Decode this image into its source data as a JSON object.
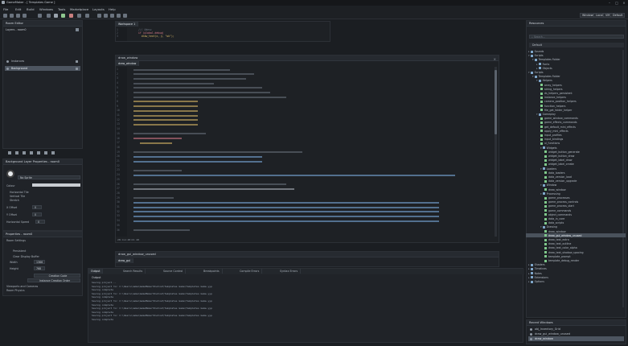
{
  "app": {
    "title": "GameMaker - [ Templates Game ]"
  },
  "menu": [
    "File",
    "Edit",
    "Build",
    "Windows",
    "Tools",
    "Marketplace",
    "Layouts",
    "Help"
  ],
  "layout_buttons": [
    "Windows",
    "Local",
    "VM",
    "Default",
    "Initial"
  ],
  "room_editor": {
    "title": "Room Editor",
    "room_name": "Layers - room0",
    "layers": [
      {
        "name": "Instances",
        "selected": false
      },
      {
        "name": "Background",
        "selected": true
      }
    ],
    "layer_props_title": "Background Layer Properties - room0",
    "colour_label": "Colour",
    "no_sprite": "No Sprite",
    "checks": [
      "Horizontal Tile",
      "Vertical Tile",
      "Stretch"
    ],
    "fields": [
      {
        "label": "X Offset",
        "value": "0"
      },
      {
        "label": "Y Offset",
        "value": "0"
      },
      {
        "label": "Horizontal Speed",
        "value": "0"
      }
    ],
    "room_props_title": "Properties - room0",
    "room_settings": "Room Settings",
    "persistent": "Persistent",
    "clear_display": "Clear Display Buffer",
    "width_label": "Width",
    "width_value": "1366",
    "height_label": "Height",
    "height_value": "768",
    "creation_code": "Creation Code",
    "instance_order": "Instance Creation Order",
    "viewports": "Viewports and Cameras",
    "physics": "Room Physics"
  },
  "script_small": {
    "tab": "Workspace 1",
    "lines": [
      "1",
      "2",
      "3"
    ],
    "code": [
      "/// @desc",
      "if (global.debug)",
      "  draw_text(x, y, \"ok\");"
    ]
  },
  "script_main": {
    "window_title": "draw_window",
    "tab": "draw_window",
    "lines": [
      "1",
      "2",
      "3",
      "4",
      "5",
      "6",
      "7",
      "8",
      "9",
      "10",
      "11",
      "12",
      "13",
      "14",
      "15",
      "16",
      "17",
      "18",
      "19",
      "20",
      "21",
      "22",
      "23",
      "24",
      "25",
      "26",
      "27",
      "28",
      "29",
      "30",
      "31",
      "32",
      "33",
      "34",
      "35",
      "36"
    ],
    "status": "28:  Col: 48  Ch: 48"
  },
  "script_footer": {
    "tab": "draw_gui",
    "title": "draw_gui_window_unused"
  },
  "output": {
    "tabs": [
      "Output",
      "Search Results",
      "Source Control",
      "Breakpoints",
      "Compile Errors",
      "Syntax Errors"
    ],
    "title": "Output",
    "lines": [
      "Saving project...",
      "Saving project to: C:\\Users\\name\\GameMakerStudio2\\Templates Game\\Templates Game.yyp",
      "Saving complete",
      "Saving project to: C:\\Users\\name\\GameMakerStudio2\\Templates Game\\Templates Game.yyp",
      "Saving complete",
      "Saving project to: C:\\Users\\name\\GameMakerStudio2\\Templates Game\\Templates Game.yyp",
      "Saving complete",
      "Saving project to: C:\\Users\\name\\GameMakerStudio2\\Templates Game\\Templates Game.yyp",
      "Saving complete",
      "Saving project to: C:\\Users\\name\\GameMakerStudio2\\Templates Game\\Templates Game.yyp",
      "Saving complete"
    ]
  },
  "resources": {
    "title": "Resources",
    "search_placeholder": "Search...",
    "filter": "Default",
    "tree": [
      {
        "d": 0,
        "t": "Sounds",
        "o": false
      },
      {
        "d": 0,
        "t": "Scripts",
        "o": true
      },
      {
        "d": 1,
        "t": "Templates Folder",
        "o": true
      },
      {
        "d": 2,
        "t": "Fonts",
        "o": false
      },
      {
        "d": 2,
        "t": "Objects",
        "o": false
      },
      {
        "d": 0,
        "t": "Scripts",
        "o": true
      },
      {
        "d": 1,
        "t": "Templates Folder",
        "o": true
      },
      {
        "d": 2,
        "t": "Helpers",
        "o": true
      },
      {
        "d": 3,
        "t": "array_helpers",
        "o": null
      },
      {
        "d": 3,
        "t": "string_helpers",
        "o": null
      },
      {
        "d": 3,
        "t": "ds_helpers_persistent",
        "o": null
      },
      {
        "d": 3,
        "t": "instance_helpers",
        "o": null
      },
      {
        "d": 3,
        "t": "camera_position_helpers",
        "o": null
      },
      {
        "d": 3,
        "t": "function_helpers",
        "o": null
      },
      {
        "d": 3,
        "t": "file_get_folder_helper",
        "o": null
      },
      {
        "d": 2,
        "t": "Gameplay",
        "o": true
      },
      {
        "d": 3,
        "t": "game_window_commands",
        "o": null
      },
      {
        "d": 3,
        "t": "game_effects_commands",
        "o": null
      },
      {
        "d": 3,
        "t": "get_default_mini_effects",
        "o": null
      },
      {
        "d": 3,
        "t": "apply_mini_effects",
        "o": null
      },
      {
        "d": 3,
        "t": "input_profiles",
        "o": null
      },
      {
        "d": 3,
        "t": "input_bindings",
        "o": null
      },
      {
        "d": 3,
        "t": "ui_functions",
        "o": null
      },
      {
        "d": 3,
        "t": "Widgets",
        "o": true
      },
      {
        "d": 4,
        "t": "widget_button_generate",
        "o": null
      },
      {
        "d": 4,
        "t": "widget_button_draw",
        "o": null
      },
      {
        "d": 4,
        "t": "widget_label_draw",
        "o": null
      },
      {
        "d": 4,
        "t": "widget_label_create",
        "o": null
      },
      {
        "d": 3,
        "t": "Loaders",
        "o": true
      },
      {
        "d": 4,
        "t": "data_loaders",
        "o": null
      },
      {
        "d": 4,
        "t": "data_version_load",
        "o": null
      },
      {
        "d": 4,
        "t": "data_version_upgrade",
        "o": null
      },
      {
        "d": 3,
        "t": "Window",
        "o": true
      },
      {
        "d": 4,
        "t": "draw_window",
        "o": null
      },
      {
        "d": 3,
        "t": "Processing",
        "o": true
      },
      {
        "d": 4,
        "t": "game_processes",
        "o": null
      },
      {
        "d": 4,
        "t": "game_process_controls",
        "o": null
      },
      {
        "d": 4,
        "t": "game_process_start",
        "o": null
      },
      {
        "d": 4,
        "t": "game_commands",
        "o": null
      },
      {
        "d": 4,
        "t": "object_commands",
        "o": null
      },
      {
        "d": 4,
        "t": "data_in_core",
        "o": null
      },
      {
        "d": 4,
        "t": "data_scripts",
        "o": null
      },
      {
        "d": 3,
        "t": "Drawing",
        "o": true
      },
      {
        "d": 4,
        "t": "draw_window",
        "o": null
      },
      {
        "d": 4,
        "t": "draw_gui_window_unused",
        "o": null,
        "sel": true
      },
      {
        "d": 4,
        "t": "draw_text_extra",
        "o": null
      },
      {
        "d": 4,
        "t": "draw_text_outline",
        "o": null
      },
      {
        "d": 4,
        "t": "draw_text_color_alpha",
        "o": null
      },
      {
        "d": 4,
        "t": "draw_text_shadow_spacing",
        "o": null
      },
      {
        "d": 4,
        "t": "template_prompt",
        "o": null
      },
      {
        "d": 4,
        "t": "template_debug_render",
        "o": null
      },
      {
        "d": 0,
        "t": "Shaders",
        "o": false
      },
      {
        "d": 0,
        "t": "Timelines",
        "o": false
      },
      {
        "d": 0,
        "t": "Notes",
        "o": false
      },
      {
        "d": 0,
        "t": "Extensions",
        "o": false
      },
      {
        "d": 0,
        "t": "Options",
        "o": false
      }
    ]
  },
  "recent": {
    "title": "Recent Windows",
    "items": [
      {
        "t": "obj_Inventory_Grid",
        "sel": false
      },
      {
        "t": "draw_gui_window_unused",
        "sel": false
      },
      {
        "t": "draw_window",
        "sel": true
      }
    ]
  },
  "colors": {
    "accent": "#4a525c",
    "keyword": "#d97a8a",
    "variable": "#e2c06a",
    "function": "#7fb3e8"
  }
}
